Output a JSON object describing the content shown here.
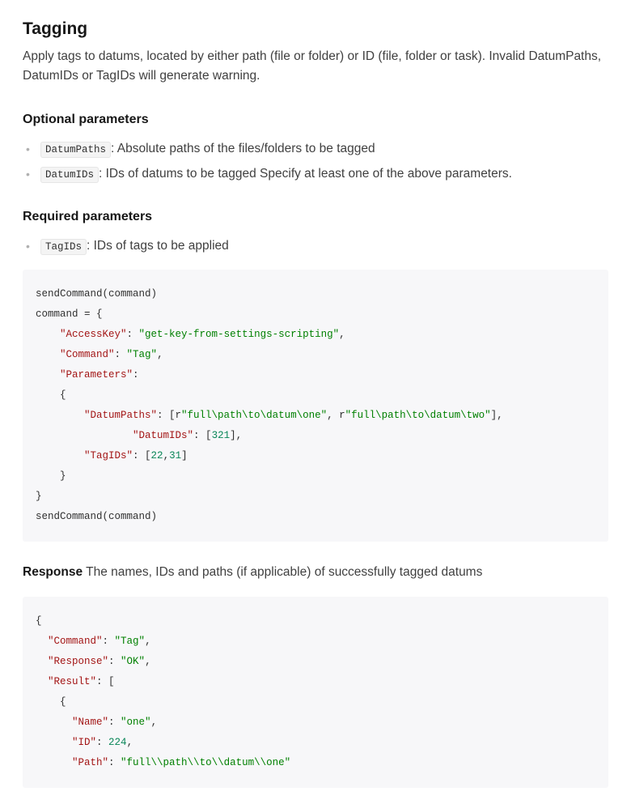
{
  "heading": "Tagging",
  "lead": "Apply tags to datums, located by either path (file or folder) or ID (file, folder or task). Invalid DatumPaths, DatumIDs or TagIDs will generate warning.",
  "optional_heading": "Optional parameters",
  "optional_params": [
    {
      "code": "DatumPaths",
      "desc": ": Absolute paths of the files/folders to be tagged"
    },
    {
      "code": "DatumIDs",
      "desc": ": IDs of datums to be tagged Specify at least one of the above parameters."
    }
  ],
  "required_heading": "Required parameters",
  "required_params": [
    {
      "code": "TagIDs",
      "desc": ": IDs of tags to be applied"
    }
  ],
  "code1": {
    "l1": "sendCommand(command)",
    "l2": "command = {",
    "k_access": "\"AccessKey\"",
    "v_access": "\"get-key-from-settings-scripting\"",
    "k_cmd": "\"Command\"",
    "v_cmd": "\"Tag\"",
    "k_params": "\"Parameters\"",
    "k_dpaths": "\"DatumPaths\"",
    "v_dpath1": "\"full\\path\\to\\datum\\one\"",
    "v_dpath2": "\"full\\path\\to\\datum\\two\"",
    "k_dids": "\"DatumIDs\"",
    "v_did": "321",
    "k_tagids": "\"TagIDs\"",
    "v_tag1": "22",
    "v_tag2": "31",
    "l_end": "sendCommand(command)"
  },
  "response_label": "Response",
  "response_text": " The names, IDs and paths (if applicable) of successfully tagged datums",
  "code2": {
    "k_cmd": "\"Command\"",
    "v_cmd": "\"Tag\"",
    "k_resp": "\"Response\"",
    "v_resp": "\"OK\"",
    "k_result": "\"Result\"",
    "k_name": "\"Name\"",
    "v_name": "\"one\"",
    "k_id": "\"ID\"",
    "v_id": "224",
    "k_path": "\"Path\"",
    "v_path": "\"full\\\\path\\\\to\\\\datum\\\\one\""
  }
}
